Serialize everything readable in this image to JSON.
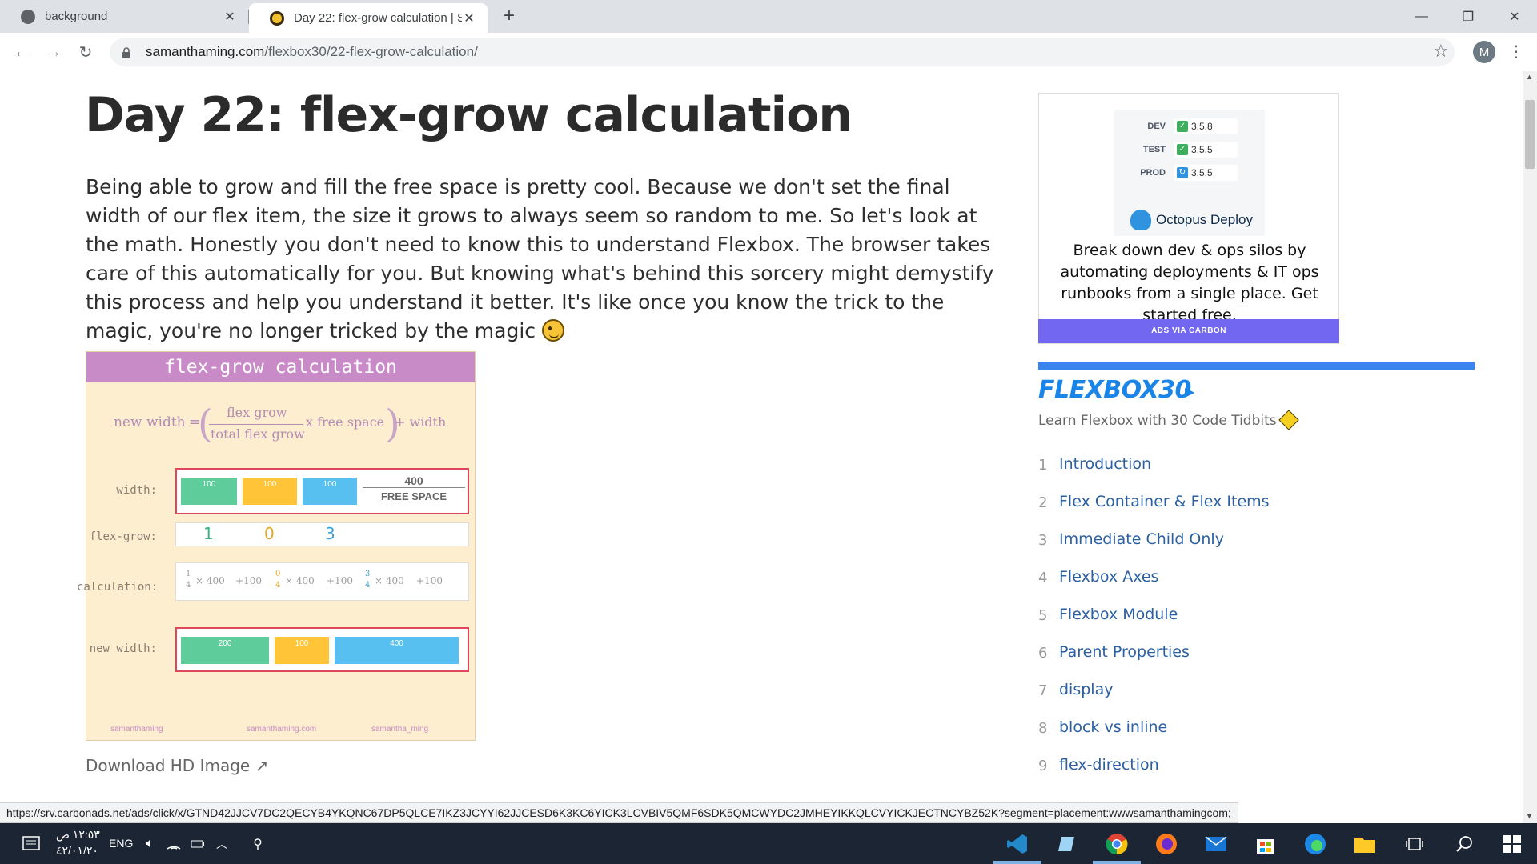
{
  "browser": {
    "tabs": [
      {
        "title": "background",
        "active": false
      },
      {
        "title": "Day 22: flex-grow calculation | Sa",
        "active": true
      }
    ],
    "url_host": "samanthaming.com",
    "url_path": "/flexbox30/22-flex-grow-calculation/",
    "profile_initial": "M"
  },
  "article": {
    "title": "Day 22: flex-grow calculation",
    "intro": "Being able to grow and fill the free space is pretty cool. Because we don't set the final width of our flex item, the size it grows to always seem so random to me. So let's look at the math. Honestly you don't need to know this to understand Flexbox. The browser takes care of this automatically for you. But knowing what's behind this sorcery might demystify this process and help you understand it better. It's like once you know the trick to the magic, you're no longer tricked by the magic",
    "download_label": "Download HD Image"
  },
  "infographic": {
    "header": "flex-grow calculation",
    "formula": {
      "lhs": "new width",
      "eq": "=",
      "numerator": "flex grow",
      "denominator": "total flex grow",
      "times": "x free space",
      "plus": "+ width"
    },
    "width_label": "width:",
    "width_blocks": [
      "100",
      "100",
      "100"
    ],
    "free_space_value": "400",
    "free_space_label": "FREE SPACE",
    "flexgrow_label": "flex-grow:",
    "flexgrow_values": [
      "1",
      "0",
      "3"
    ],
    "calculation_label": "calculation:",
    "calc_parts": [
      "1",
      "4",
      "× 400",
      "+100",
      "0",
      "4",
      "× 400",
      "+100",
      "3",
      "4",
      "× 400",
      "+100"
    ],
    "newwidth_label": "new width:",
    "newwidth_blocks": [
      "200",
      "100",
      "400"
    ],
    "footer": [
      "samanthaming",
      "samanthaming.com",
      "samantha_ming"
    ]
  },
  "ad": {
    "envs": [
      {
        "env": "DEV",
        "version": "3.5.8"
      },
      {
        "env": "TEST",
        "version": "3.5.5"
      },
      {
        "env": "PROD",
        "version": "3.5.5"
      }
    ],
    "brand": "Octopus Deploy",
    "text": "Break down dev & ops silos by automating deployments & IT ops runbooks from a single place. Get started free.",
    "via": "ADS VIA CARBON"
  },
  "sidebar": {
    "title": "FLEXBOX30",
    "subtitle": "Learn Flexbox with 30 Code Tidbits",
    "lessons": [
      {
        "num": "1",
        "name": "Introduction"
      },
      {
        "num": "2",
        "name": "Flex Container & Flex Items"
      },
      {
        "num": "3",
        "name": "Immediate Child Only"
      },
      {
        "num": "4",
        "name": "Flexbox Axes"
      },
      {
        "num": "5",
        "name": "Flexbox Module"
      },
      {
        "num": "6",
        "name": "Parent Properties"
      },
      {
        "num": "7",
        "name": "display"
      },
      {
        "num": "8",
        "name": "block vs inline"
      },
      {
        "num": "9",
        "name": "flex-direction"
      }
    ]
  },
  "status_url": "https://srv.carbonads.net/ads/click/x/GTND42JJCV7DC2QECYB4YKQNC67DP5QLCE7IKZ3JCYYI62JJCESD6K3KC6YICK3LCVBIV5QMF6SDK5QMCWYDC2JMHEYIKKQLCVYICKJECTNCYBZ52K?segment=placement:wwwsamanthamingcom;",
  "taskbar": {
    "time": "١٢:٥٣ ص",
    "date": "٤٢/٠١/٢٠",
    "lang": "ENG"
  },
  "colors": {
    "accent": "#1a85e9",
    "carbon": "#7267f0",
    "infographic_header": "#c98bc7",
    "infographic_bg": "#fdeed0"
  }
}
